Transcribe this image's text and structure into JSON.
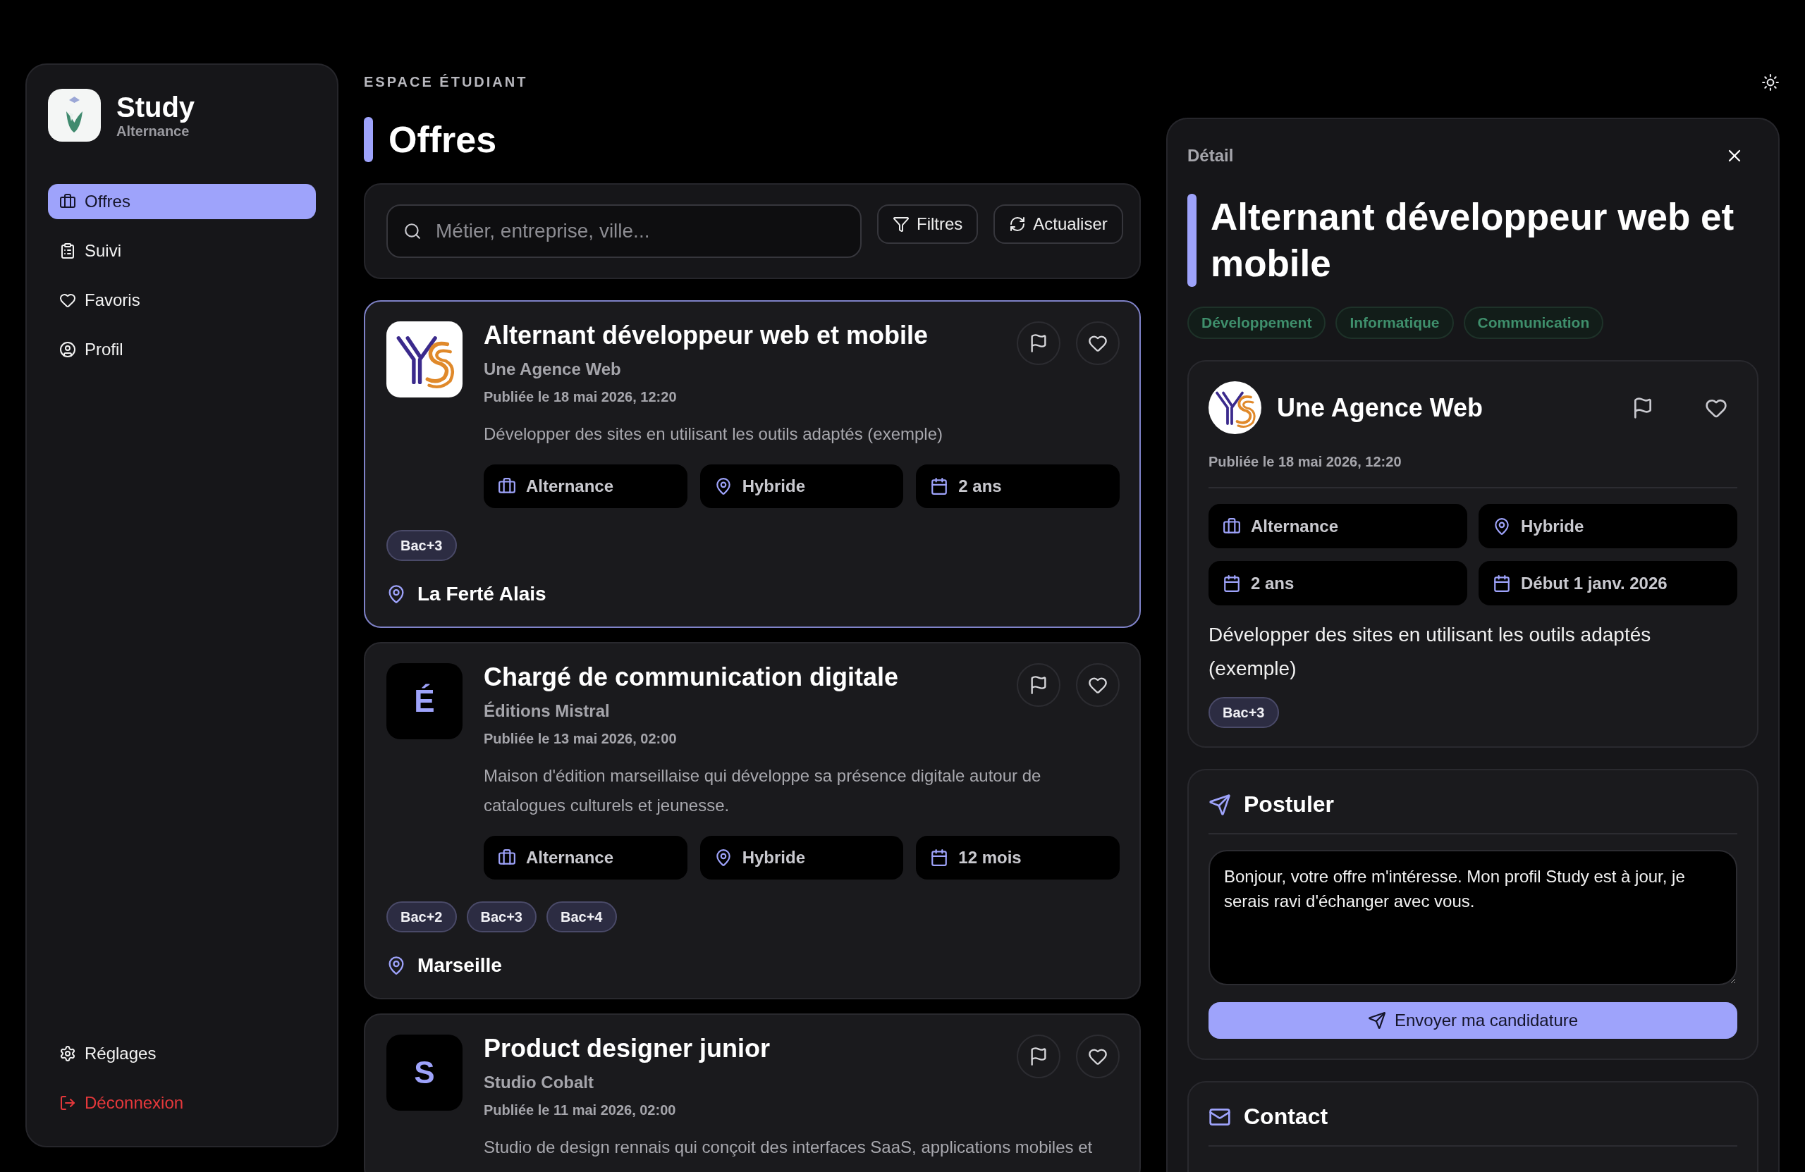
{
  "app": {
    "name": "Study",
    "subtitle": "Alternance"
  },
  "nav": [
    {
      "label": "Offres",
      "kind": "offers",
      "selected": true
    },
    {
      "label": "Suivi",
      "kind": "tracking",
      "selected": false
    },
    {
      "label": "Favoris",
      "kind": "favorites",
      "selected": false
    },
    {
      "label": "Profil",
      "kind": "profile",
      "selected": false
    }
  ],
  "nav_bottom": [
    {
      "label": "Réglages",
      "kind": "settings"
    },
    {
      "label": "Déconnexion",
      "kind": "logout"
    }
  ],
  "eyebrow": "ESPACE ÉTUDIANT",
  "page_title": "Offres",
  "search": {
    "placeholder": "Métier, entreprise, ville..."
  },
  "toolbar_buttons": [
    {
      "label": "Filtres",
      "kind": "filter"
    },
    {
      "label": "Actualiser",
      "kind": "refresh"
    }
  ],
  "offers": [
    {
      "selected": true,
      "logo": {
        "kind": "image"
      },
      "title": "Alternant développeur web et mobile",
      "company": "Une Agence Web",
      "published": "Publiée le 18 mai 2026, 12:20",
      "description": "Développer des sites en utilisant les outils adaptés (exemple)",
      "facts": [
        {
          "kind": "contract",
          "text": "Alternance"
        },
        {
          "kind": "location",
          "text": "Hybride"
        },
        {
          "kind": "duration",
          "text": "2 ans"
        }
      ],
      "levels": [
        "Bac+3"
      ],
      "city": "La Ferté Alais"
    },
    {
      "selected": false,
      "logo": {
        "kind": "letter",
        "text": "É"
      },
      "title": "Chargé de communication digitale",
      "company": "Éditions Mistral",
      "published": "Publiée le 13 mai 2026, 02:00",
      "description": "Maison d'édition marseillaise qui développe sa présence digitale autour de catalogues culturels et jeunesse.",
      "facts": [
        {
          "kind": "contract",
          "text": "Alternance"
        },
        {
          "kind": "location",
          "text": "Hybride"
        },
        {
          "kind": "duration",
          "text": "12 mois"
        }
      ],
      "levels": [
        "Bac+2",
        "Bac+3",
        "Bac+4"
      ],
      "city": "Marseille"
    },
    {
      "selected": false,
      "logo": {
        "kind": "letter",
        "text": "S"
      },
      "title": "Product designer junior",
      "company": "Studio Cobalt",
      "published": "Publiée le 11 mai 2026, 02:00",
      "description": "Studio de design rennais qui conçoit des interfaces SaaS, applications mobiles et"
    }
  ],
  "detail": {
    "label": "Détail",
    "title": "Alternant développeur web et mobile",
    "categories": [
      "Développement",
      "Informatique",
      "Communication"
    ],
    "company": "Une Agence Web",
    "published": "Publiée le 18 mai 2026, 12:20",
    "facts": [
      {
        "kind": "contract",
        "text": "Alternance"
      },
      {
        "kind": "location",
        "text": "Hybride"
      },
      {
        "kind": "duration",
        "text": "2 ans"
      },
      {
        "kind": "start",
        "text": "Début 1 janv. 2026"
      }
    ],
    "description": "Développer des sites en utilisant les outils adaptés (exemple)",
    "levels": [
      "Bac+3"
    ]
  },
  "apply": {
    "title": "Postuler",
    "message": "Bonjour, votre offre m'intéresse. Mon profil Study est à jour, je serais ravi d'échanger avec vous.",
    "button": "Envoyer ma candidature"
  },
  "contact": {
    "title": "Contact"
  }
}
